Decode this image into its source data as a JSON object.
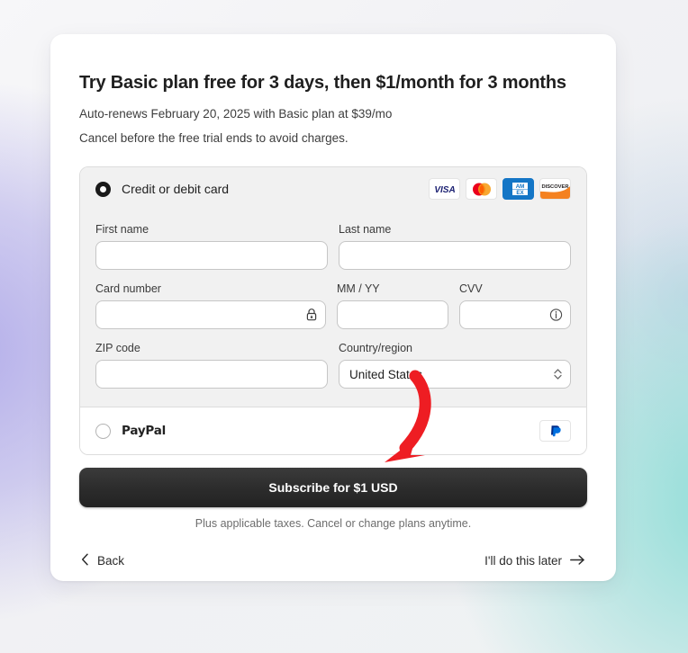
{
  "page": {
    "background_left_accent": "#b0aae9",
    "background_right_accent": "#8adcd6"
  },
  "header": {
    "title": "Try Basic plan free for 3 days, then $1/month for 3 months",
    "renewal_note": "Auto-renews February 20, 2025 with Basic plan at $39/mo",
    "cancel_note": "Cancel before the free trial ends to avoid charges."
  },
  "payment": {
    "card_method": {
      "label": "Credit or debit card",
      "selected": true,
      "radio_icon": "radio-selected-icon",
      "brands": [
        {
          "name": "visa-logo",
          "text": "VISA"
        },
        {
          "name": "mastercard-logo",
          "text": ""
        },
        {
          "name": "amex-logo",
          "text": "AMEX"
        },
        {
          "name": "discover-logo",
          "text": "DISCOVER"
        }
      ]
    },
    "fields": {
      "first_name": {
        "label": "First name",
        "value": "",
        "placeholder": ""
      },
      "last_name": {
        "label": "Last name",
        "value": "",
        "placeholder": ""
      },
      "card_number": {
        "label": "Card number",
        "value": "",
        "placeholder": "",
        "icon": "lock-icon"
      },
      "expiry": {
        "label": "MM / YY",
        "value": "",
        "placeholder": ""
      },
      "cvv": {
        "label": "CVV",
        "value": "",
        "placeholder": "",
        "icon": "info-icon"
      },
      "zip": {
        "label": "ZIP code",
        "value": "",
        "placeholder": ""
      },
      "country": {
        "label": "Country/region",
        "value": "United States",
        "icon": "chevron-updown-icon",
        "options": [
          "United States"
        ]
      }
    },
    "paypal_method": {
      "label": "PayPal",
      "selected": false,
      "radio_icon": "radio-unselected-icon",
      "brand_icon": "paypal-logo"
    }
  },
  "cta": {
    "subscribe_label": "Subscribe for $1 USD",
    "fineprint": "Plus applicable taxes. Cancel or change plans anytime."
  },
  "footer": {
    "back_label": "Back",
    "back_icon": "chevron-left-icon",
    "later_label": "I'll do this later",
    "later_icon": "arrow-right-icon"
  },
  "annotation": {
    "arrow_color": "#ee1d23",
    "points_to": "Subscribe for $1 USD"
  }
}
